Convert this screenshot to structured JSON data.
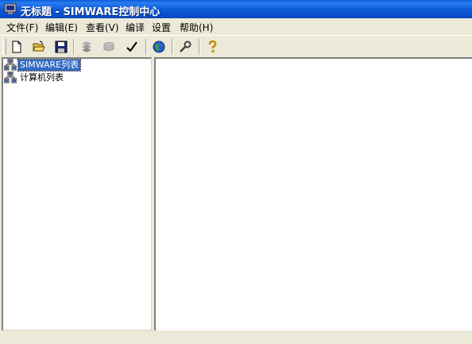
{
  "window": {
    "title": "无标题 - SIMWARE控制中心"
  },
  "menu": {
    "items": [
      "文件(F)",
      "编辑(E)",
      "查看(V)",
      "编译",
      "设置",
      "帮助(H)"
    ]
  },
  "toolbar": {
    "buttons": [
      {
        "icon": "new-document-icon",
        "enabled": true
      },
      {
        "icon": "open-folder-icon",
        "enabled": true
      },
      {
        "icon": "save-icon",
        "enabled": true
      },
      {
        "icon": "stack-icon",
        "enabled": false
      },
      {
        "icon": "disk-icon",
        "enabled": false
      },
      {
        "icon": "checkmark-icon",
        "enabled": true
      },
      {
        "icon": "globe-icon",
        "enabled": true
      },
      {
        "icon": "wrench-icon",
        "enabled": true
      },
      {
        "icon": "help-icon",
        "enabled": true
      }
    ]
  },
  "tree": {
    "items": [
      {
        "label": "SIMWARE列表",
        "icon": "network-computers-icon",
        "selected": true
      },
      {
        "label": "计算机列表",
        "icon": "network-computers-icon",
        "selected": false
      }
    ]
  }
}
